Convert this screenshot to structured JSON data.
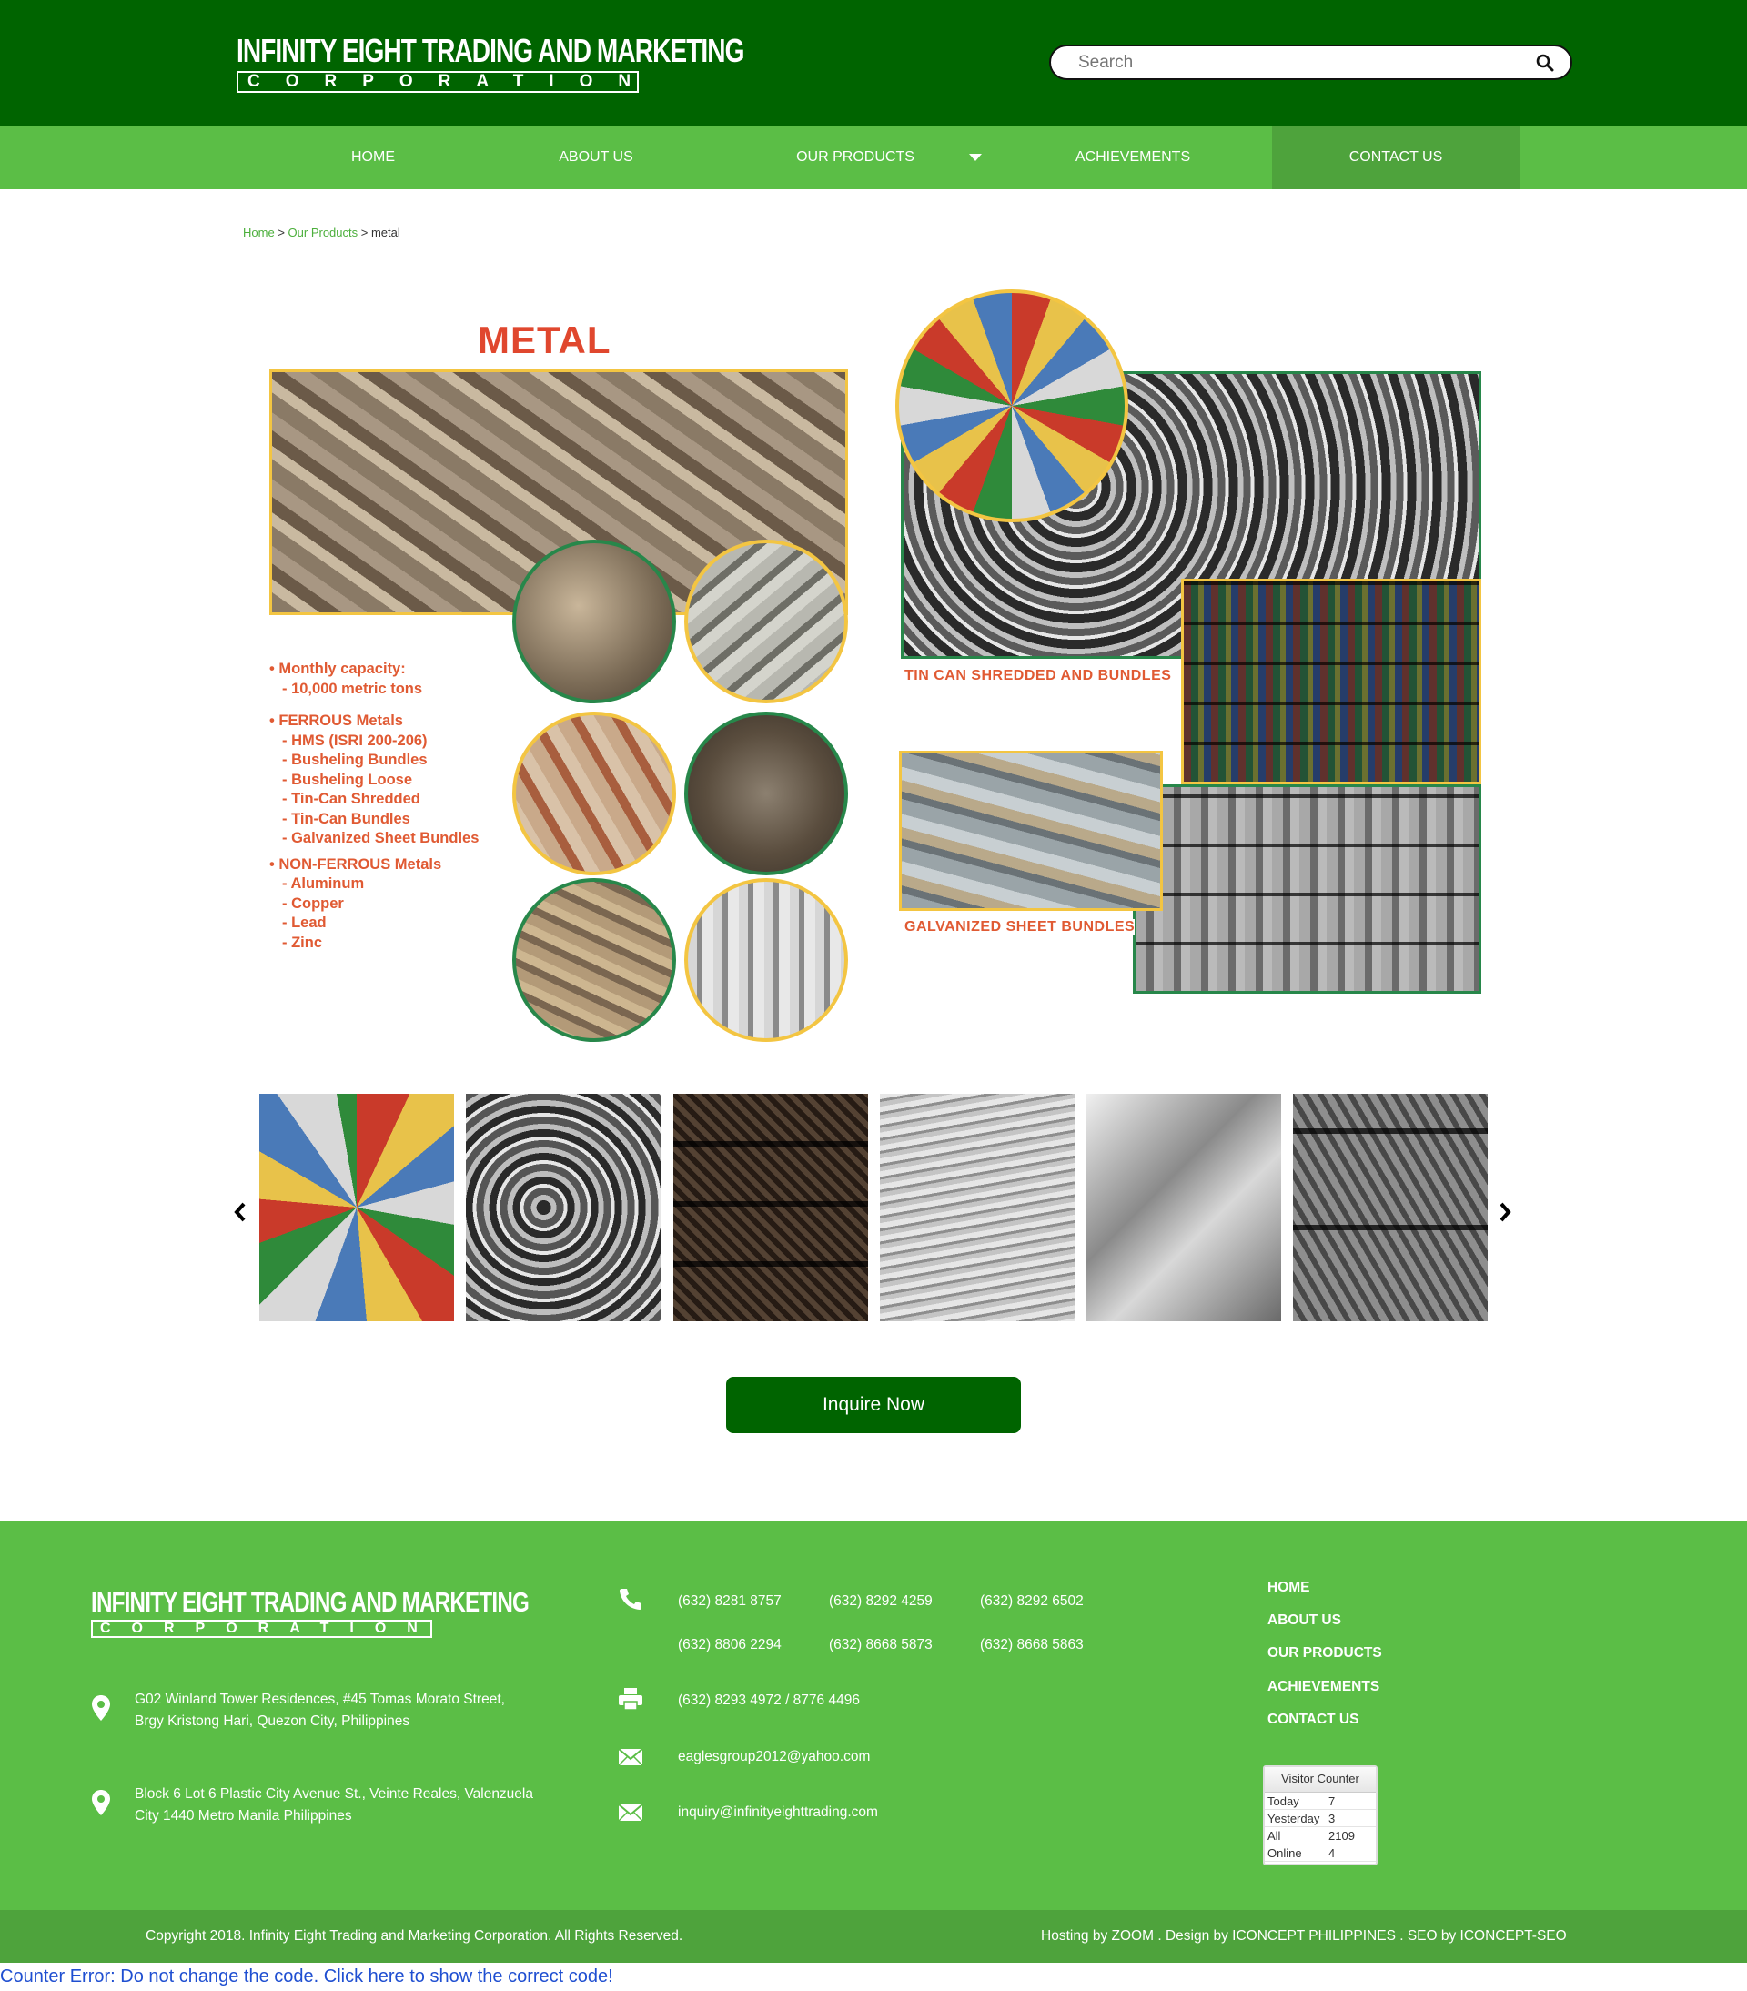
{
  "header": {
    "logo_line1": "INFINITY EIGHT TRADING AND MARKETING",
    "logo_line2": "CORPORATION",
    "search_placeholder": "Search"
  },
  "nav": {
    "items": [
      {
        "label": "HOME"
      },
      {
        "label": "ABOUT US"
      },
      {
        "label": "OUR PRODUCTS"
      },
      {
        "label": "ACHIEVEMENTS"
      },
      {
        "label": "CONTACT US"
      }
    ]
  },
  "breadcrumb": {
    "home": "Home",
    "sep": ">",
    "products": "Our Products",
    "current": "metal"
  },
  "hero": {
    "title": "METAL",
    "capacity_head": "Monthly capacity:",
    "capacity_val": "- 10,000 metric tons",
    "ferrous_head": "FERROUS Metals",
    "ferrous_items": [
      "- HMS (ISRI 200-206)",
      "- Busheling Bundles",
      "- Busheling Loose",
      "- Tin-Can Shredded",
      "- Tin-Can Bundles",
      "- Galvanized Sheet Bundles"
    ],
    "nonferrous_head": "NON-FERROUS Metals",
    "nonferrous_items": [
      "- Aluminum",
      "- Copper",
      "- Lead",
      "- Zinc"
    ],
    "caption_tin": "TIN CAN SHREDDED AND BUNDLES",
    "caption_galv": "GALVANIZED SHEET BUNDLES"
  },
  "carousel": {
    "prev_icon": "chevron-left-icon",
    "next_icon": "chevron-right-icon"
  },
  "inquire_label": "Inquire Now",
  "footer": {
    "logo_line1": "INFINITY EIGHT TRADING AND MARKETING",
    "logo_line2": "CORPORATION",
    "address1_l1": "G02 Winland Tower Residences, #45 Tomas Morato Street,",
    "address1_l2": "Brgy Kristong Hari, Quezon City, Philippines",
    "address2_l1": "Block 6 Lot 6 Plastic City Avenue St., Veinte Reales, Valenzuela",
    "address2_l2": "City 1440 Metro Manila Philippines",
    "phones": [
      "(632) 8281 8757",
      "(632) 8292 4259",
      "(632) 8292 6502",
      "(632) 8806 2294",
      "(632) 8668 5873",
      "(632) 8668 5863"
    ],
    "fax": "(632) 8293 4972 / 8776 4496",
    "email1": "eaglesgroup2012@yahoo.com",
    "email2": "inquiry@infinityeighttrading.com",
    "nav": [
      "HOME",
      "ABOUT US",
      "OUR PRODUCTS",
      "ACHIEVEMENTS",
      "CONTACT US"
    ],
    "counter": {
      "title": "Visitor Counter",
      "rows": [
        {
          "label": "Today",
          "value": "7"
        },
        {
          "label": "Yesterday",
          "value": "3"
        },
        {
          "label": "All",
          "value": "2109"
        },
        {
          "label": "Online",
          "value": "4"
        }
      ]
    },
    "copyright": "Copyright 2018. Infinity Eight Trading and Marketing Corporation. All Rights Reserved.",
    "credits": "Hosting by ZOOM . Design by ICONCEPT PHILIPPINES . SEO by ICONCEPT-SEO"
  },
  "counter_error": "Counter Error: Do not change the code. Click here to show the correct code!",
  "colors": {
    "header_green": "#006400",
    "nav_green": "#5bbe46",
    "active_green": "#4ea33c",
    "accent_orange": "#e05a33"
  }
}
